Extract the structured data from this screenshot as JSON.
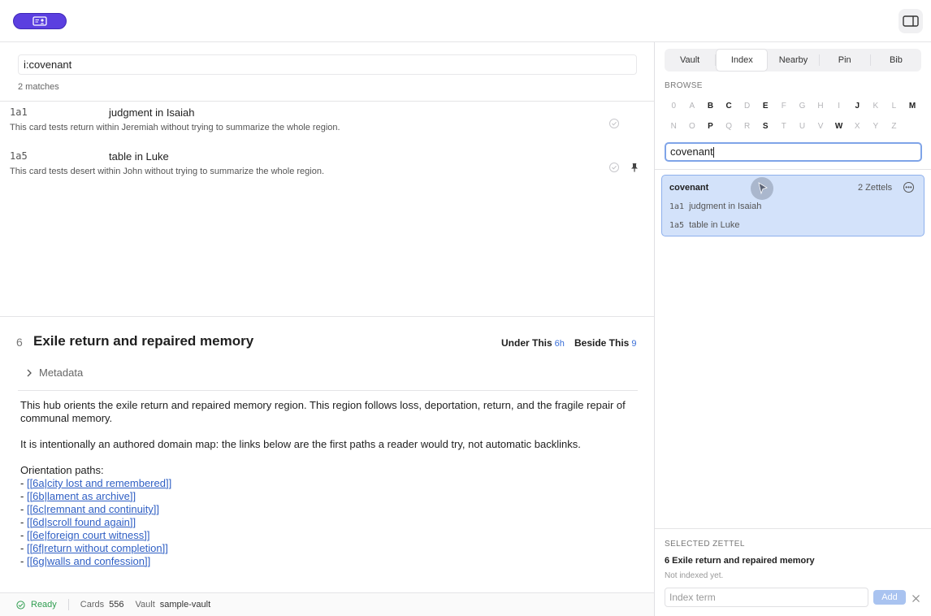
{
  "search": {
    "query": "i:covenant",
    "match_count": "2 matches"
  },
  "results": [
    {
      "id": "1a1",
      "title": "judgment in Isaiah",
      "desc": "This card tests return within Jeremiah without trying to summarize the whole region.",
      "pinned": false
    },
    {
      "id": "1a5",
      "title": "table in Luke",
      "desc": "This card tests desert within John without trying to summarize the whole region.",
      "pinned": true
    }
  ],
  "zettel": {
    "number": "6",
    "title": "Exile return and repaired memory",
    "under_label": "Under This",
    "under_count": "6h",
    "beside_label": "Beside This",
    "beside_count": "9",
    "metadata_label": "Metadata",
    "para1": "This hub orients the exile return and repaired memory region. This region follows loss, deportation, return, and the fragile repair of communal memory.",
    "para2": "It is intentionally an authored domain map: the links below are the first paths a reader would try, not automatic backlinks.",
    "paths_label": "Orientation paths:",
    "links": [
      "[[6a|city lost and remembered]]",
      "[[6b|lament as archive]]",
      "[[6c|remnant and continuity]]",
      "[[6d|scroll found again]]",
      "[[6e|foreign court witness]]",
      "[[6f|return without completion]]",
      "[[6g|walls and confession]]"
    ]
  },
  "status": {
    "ready": "Ready",
    "cards_label": "Cards",
    "cards_value": "556",
    "vault_label": "Vault",
    "vault_value": "sample-vault"
  },
  "side": {
    "tabs": [
      "Vault",
      "Index",
      "Nearby",
      "Pin",
      "Bib"
    ],
    "active_tab": "Index",
    "browse_label": "BROWSE",
    "letters_row1": [
      {
        "c": "0",
        "on": false
      },
      {
        "c": "A",
        "on": false
      },
      {
        "c": "B",
        "on": true
      },
      {
        "c": "C",
        "on": true
      },
      {
        "c": "D",
        "on": false
      },
      {
        "c": "E",
        "on": true
      },
      {
        "c": "F",
        "on": false
      },
      {
        "c": "G",
        "on": false
      },
      {
        "c": "H",
        "on": false
      },
      {
        "c": "I",
        "on": false
      },
      {
        "c": "J",
        "on": true
      },
      {
        "c": "K",
        "on": false
      },
      {
        "c": "L",
        "on": false
      },
      {
        "c": "M",
        "on": true
      }
    ],
    "letters_row2": [
      {
        "c": "N",
        "on": false
      },
      {
        "c": "O",
        "on": false
      },
      {
        "c": "P",
        "on": true
      },
      {
        "c": "Q",
        "on": false
      },
      {
        "c": "R",
        "on": false
      },
      {
        "c": "S",
        "on": true
      },
      {
        "c": "T",
        "on": false
      },
      {
        "c": "U",
        "on": false
      },
      {
        "c": "V",
        "on": false
      },
      {
        "c": "W",
        "on": true
      },
      {
        "c": "X",
        "on": false
      },
      {
        "c": "Y",
        "on": false
      },
      {
        "c": "Z",
        "on": false
      }
    ],
    "index_query": "covenant",
    "term": {
      "name": "covenant",
      "count": "2 Zettels",
      "entries": [
        {
          "id": "1a1",
          "title": "judgment in Isaiah"
        },
        {
          "id": "1a5",
          "title": "table in Luke"
        }
      ]
    },
    "selected_label": "SELECTED ZETTEL",
    "selected_title": "6 Exile return and repaired memory",
    "selected_note": "Not indexed yet.",
    "index_term_placeholder": "Index term",
    "add_label": "Add"
  },
  "colors": {
    "accent": "#5b3fe0",
    "link": "#2f5fc4",
    "selected_bg": "#d3e2fa",
    "ok": "#2e9d4f"
  }
}
